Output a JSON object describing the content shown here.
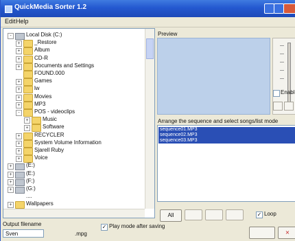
{
  "window": {
    "title": "QuickMedia Sorter 1.2"
  },
  "menu": {
    "edit": "Edit",
    "help": "Help"
  },
  "tree": {
    "nodes": [
      {
        "label": "Local Disk (C:)",
        "kind": "drive",
        "expander": "-",
        "depth": 0
      },
      {
        "label": "_Restore",
        "kind": "folder",
        "expander": "+",
        "depth": 1
      },
      {
        "label": "Album",
        "kind": "folder",
        "expander": "+",
        "depth": 1
      },
      {
        "label": "CD-R",
        "kind": "folder",
        "expander": "+",
        "depth": 1
      },
      {
        "label": "Documents and Settings",
        "kind": "folder",
        "expander": "+",
        "depth": 1
      },
      {
        "label": "FOUND.000",
        "kind": "folder",
        "expander": "",
        "depth": 1
      },
      {
        "label": "Games",
        "kind": "folder",
        "expander": "+",
        "depth": 1
      },
      {
        "label": "lw",
        "kind": "folder",
        "expander": "+",
        "depth": 1
      },
      {
        "label": "Movies",
        "kind": "folder",
        "expander": "+",
        "depth": 1
      },
      {
        "label": "MP3",
        "kind": "folder",
        "expander": "+",
        "depth": 1
      },
      {
        "label": "POS - videoclips",
        "kind": "folder",
        "expander": "-",
        "depth": 1
      },
      {
        "label": "Music",
        "kind": "folder",
        "expander": "+",
        "depth": 2
      },
      {
        "label": "Software",
        "kind": "folder",
        "expander": "+",
        "depth": 2
      },
      {
        "label": "RECYCLER",
        "kind": "folder",
        "expander": "+",
        "depth": 1
      },
      {
        "label": "System Volume Information",
        "kind": "folder",
        "expander": "+",
        "depth": 1
      },
      {
        "label": "Sjarell Ruby",
        "kind": "folder",
        "expander": "+",
        "depth": 1
      },
      {
        "label": "Voice",
        "kind": "folder",
        "expander": "+",
        "depth": 1
      },
      {
        "label": "(E:)",
        "kind": "drive",
        "expander": "+",
        "depth": 0
      },
      {
        "label": "(E:)",
        "kind": "drive",
        "expander": "+",
        "depth": 0
      },
      {
        "label": "(F:)",
        "kind": "drive",
        "expander": "+",
        "depth": 0
      },
      {
        "label": "(G:)",
        "kind": "drive",
        "expander": "+",
        "depth": 0
      },
      {
        "label": "....",
        "kind": "none",
        "expander": "",
        "depth": 0
      },
      {
        "label": "Wallpapers",
        "kind": "folder",
        "expander": "+",
        "depth": 0
      }
    ]
  },
  "preview": {
    "label": "Preview",
    "enable_label": "Enable"
  },
  "sequence": {
    "label": "Arrange the sequence and select songs/list mode",
    "items": [
      "sequence01.MP3",
      "sequence02.MP3",
      "sequence03.MP3"
    ],
    "all_label": "All",
    "loop_label": "Loop",
    "loop_checked_glyph": "✓"
  },
  "output": {
    "label": "Output filename",
    "value": "Sven",
    "extension": ".mpg",
    "play_label": "Play mode after saving",
    "play_checked_glyph": "✓"
  },
  "icons": {
    "title": "app-icon",
    "expand": "expand-icon",
    "folder": "folder-icon",
    "drive": "drive-icon"
  },
  "colors": {
    "titlebar": "#2458d0",
    "selection": "#2a4fb5",
    "preview_bg": "#bcd0ea"
  }
}
